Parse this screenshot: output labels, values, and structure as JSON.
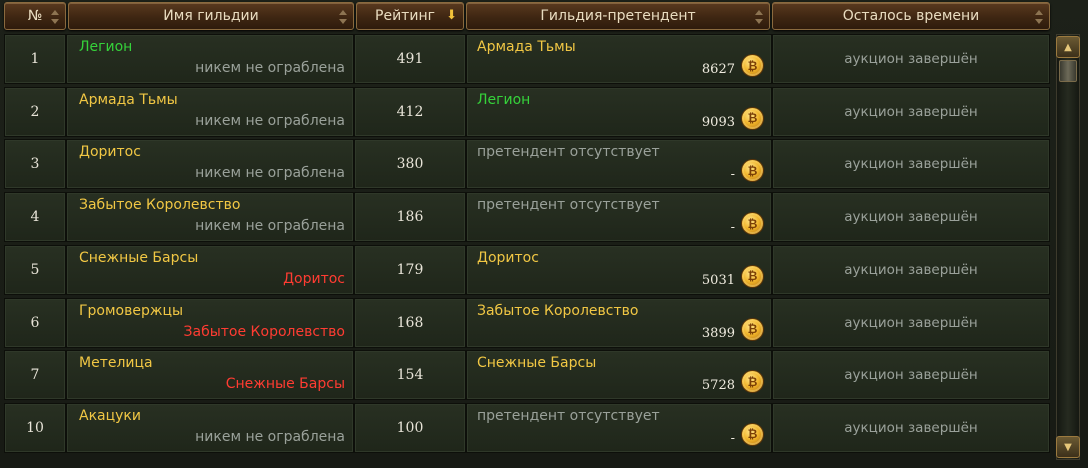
{
  "columns": {
    "num": "№",
    "guild": "Имя гильдии",
    "rating": "Рейтинг",
    "candidate": "Гильдия-претендент",
    "time": "Осталось времени"
  },
  "coin_symbol": "₿",
  "rows": [
    {
      "num": "1",
      "guild": "Легион",
      "guild_color": "#35d23a",
      "robbed_by": "никем не ограблена",
      "robbed_color": "#9aa19a",
      "rating": "491",
      "candidate": "Армада Тьмы",
      "candidate_color": "#f1c744",
      "bid": "8627",
      "time": "аукцион завершён"
    },
    {
      "num": "2",
      "guild": "Армада Тьмы",
      "guild_color": "#f1c744",
      "robbed_by": "никем не ограблена",
      "robbed_color": "#9aa19a",
      "rating": "412",
      "candidate": "Легион",
      "candidate_color": "#35d23a",
      "bid": "9093",
      "time": "аукцион завершён"
    },
    {
      "num": "3",
      "guild": "Доритос",
      "guild_color": "#f1c744",
      "robbed_by": "никем не ограблена",
      "robbed_color": "#9aa19a",
      "rating": "380",
      "candidate": "претендент отсутствует",
      "candidate_color": "#9aa19a",
      "bid": "-",
      "time": "аукцион завершён"
    },
    {
      "num": "4",
      "guild": "Забытое Королевство",
      "guild_color": "#f1c744",
      "robbed_by": "никем не ограблена",
      "robbed_color": "#9aa19a",
      "rating": "186",
      "candidate": "претендент отсутствует",
      "candidate_color": "#9aa19a",
      "bid": "-",
      "time": "аукцион завершён"
    },
    {
      "num": "5",
      "guild": "Снежные Барсы",
      "guild_color": "#f1c744",
      "robbed_by": "Доритос",
      "robbed_color": "#ff3c32",
      "rating": "179",
      "candidate": "Доритос",
      "candidate_color": "#f1c744",
      "bid": "5031",
      "time": "аукцион завершён"
    },
    {
      "num": "6",
      "guild": "Громовержцы",
      "guild_color": "#f1c744",
      "robbed_by": "Забытое Королевство",
      "robbed_color": "#ff3c32",
      "rating": "168",
      "candidate": "Забытое Королевство",
      "candidate_color": "#f1c744",
      "bid": "3899",
      "time": "аукцион завершён"
    },
    {
      "num": "7",
      "guild": "Метелица",
      "guild_color": "#f1c744",
      "robbed_by": "Снежные Барсы",
      "robbed_color": "#ff3c32",
      "rating": "154",
      "candidate": "Снежные Барсы",
      "candidate_color": "#f1c744",
      "bid": "5728",
      "time": "аукцион завершён"
    },
    {
      "num": "10",
      "guild": "Акацуки",
      "guild_color": "#f1c744",
      "robbed_by": "никем не ограблена",
      "robbed_color": "#9aa19a",
      "rating": "100",
      "candidate": "претендент отсутствует",
      "candidate_color": "#9aa19a",
      "bid": "-",
      "time": "аукцион завершён"
    }
  ]
}
